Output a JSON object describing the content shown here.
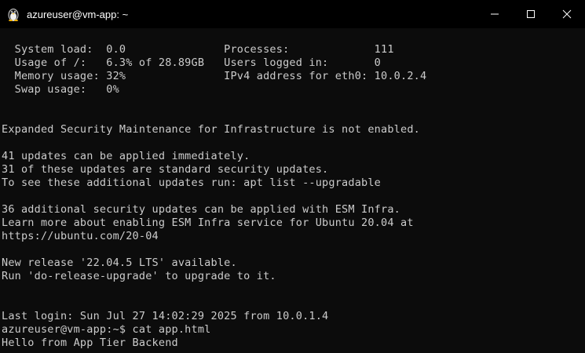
{
  "window": {
    "title": "azureuser@vm-app: ~",
    "icon": "linux-penguin-icon",
    "controls": [
      "minimize-icon",
      "maximize-icon",
      "close-icon"
    ]
  },
  "colors": {
    "background": "#0c0c0c",
    "titlebar": "#000000",
    "text": "#cccccc"
  },
  "terminal": {
    "lines": [
      "  System load:  0.0               Processes:             111",
      "  Usage of /:   6.3% of 28.89GB   Users logged in:       0",
      "  Memory usage: 32%               IPv4 address for eth0: 10.0.2.4",
      "  Swap usage:   0%",
      "",
      "",
      "Expanded Security Maintenance for Infrastructure is not enabled.",
      "",
      "41 updates can be applied immediately.",
      "31 of these updates are standard security updates.",
      "To see these additional updates run: apt list --upgradable",
      "",
      "36 additional security updates can be applied with ESM Infra.",
      "Learn more about enabling ESM Infra service for Ubuntu 20.04 at",
      "https://ubuntu.com/20-04",
      "",
      "New release '22.04.5 LTS' available.",
      "Run 'do-release-upgrade' to upgrade to it.",
      "",
      "",
      "Last login: Sun Jul 27 14:02:29 2025 from 10.0.1.4",
      "azureuser@vm-app:~$ cat app.html",
      "Hello from App Tier Backend"
    ]
  }
}
